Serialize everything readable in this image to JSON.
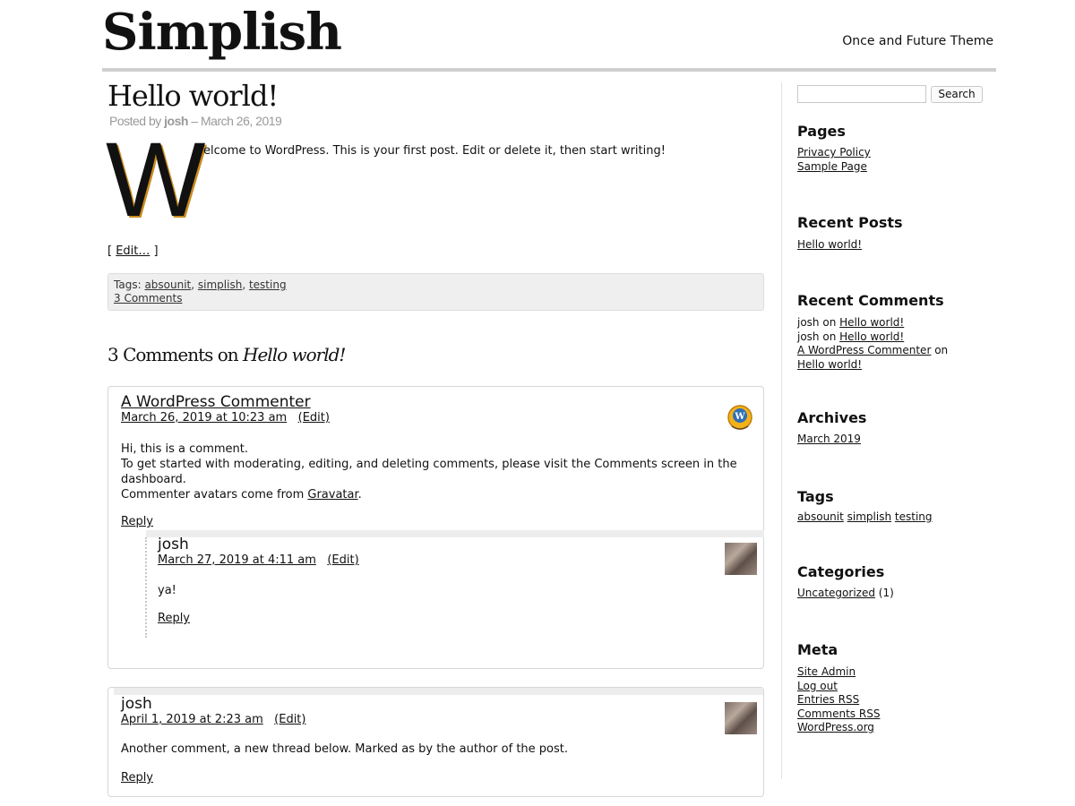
{
  "site": {
    "title": "Simplish",
    "description": "Once and Future Theme"
  },
  "post": {
    "title": "Hello world!",
    "meta_prefix": "Posted by",
    "author": "josh",
    "date_sep": " – ",
    "date": "March 26, 2019",
    "dropcap": "W",
    "body": "elcome to WordPress. This is your first post. Edit or delete it, then start writing!",
    "edit_open": "[ ",
    "edit_label": "Edit…",
    "edit_close": " ]",
    "tags_label": "Tags: ",
    "tags": [
      "absounit",
      "simplish",
      "testing"
    ],
    "comments_link": "3 Comments"
  },
  "comments": {
    "heading_prefix": "3 Comments on ",
    "heading_post": "Hello world!",
    "edit_label": "(Edit)",
    "reply_label": "Reply",
    "items": [
      {
        "author": "A WordPress Commenter",
        "date": "March 26, 2019 at 10:23 am",
        "lines": [
          "Hi, this is a comment.",
          "To get started with moderating, editing, and deleting comments, please visit the Comments screen in the dashboard.",
          "Commenter avatars come from "
        ],
        "gravatar_link": "Gravatar",
        "gravatar_after": ".",
        "avatar": "wordpress-avatar-icon"
      },
      {
        "author": "josh",
        "date": "March 27, 2019 at 4:11 am",
        "body": "ya!",
        "avatar": "user-photo-avatar"
      },
      {
        "author": "josh",
        "date": "April 1, 2019 at 2:23 am",
        "body": "Another comment, a new thread below. Marked as by the author of the post.",
        "avatar": "user-photo-avatar"
      }
    ]
  },
  "sidebar": {
    "search": {
      "value": "",
      "button_label": "Search"
    },
    "pages": {
      "title": "Pages",
      "items": [
        "Privacy Policy",
        "Sample Page"
      ]
    },
    "recent_posts": {
      "title": "Recent Posts",
      "items": [
        "Hello world!"
      ]
    },
    "recent_comments": {
      "title": "Recent Comments",
      "items": [
        {
          "author": "josh",
          "on": " on ",
          "post": "Hello world!"
        },
        {
          "author": "josh",
          "on": " on ",
          "post": "Hello world!"
        },
        {
          "author": "A WordPress Commenter",
          "on": " on ",
          "post": "Hello world!"
        }
      ]
    },
    "archives": {
      "title": "Archives",
      "items": [
        "March 2019"
      ]
    },
    "tags": {
      "title": "Tags",
      "items": [
        "absounit",
        "simplish",
        "testing"
      ]
    },
    "categories": {
      "title": "Categories",
      "items": [
        {
          "name": "Uncategorized",
          "count": "(1)"
        }
      ]
    },
    "meta": {
      "title": "Meta",
      "items": [
        "Site Admin",
        "Log out",
        "Entries RSS",
        "Comments RSS",
        "WordPress.org"
      ]
    }
  }
}
